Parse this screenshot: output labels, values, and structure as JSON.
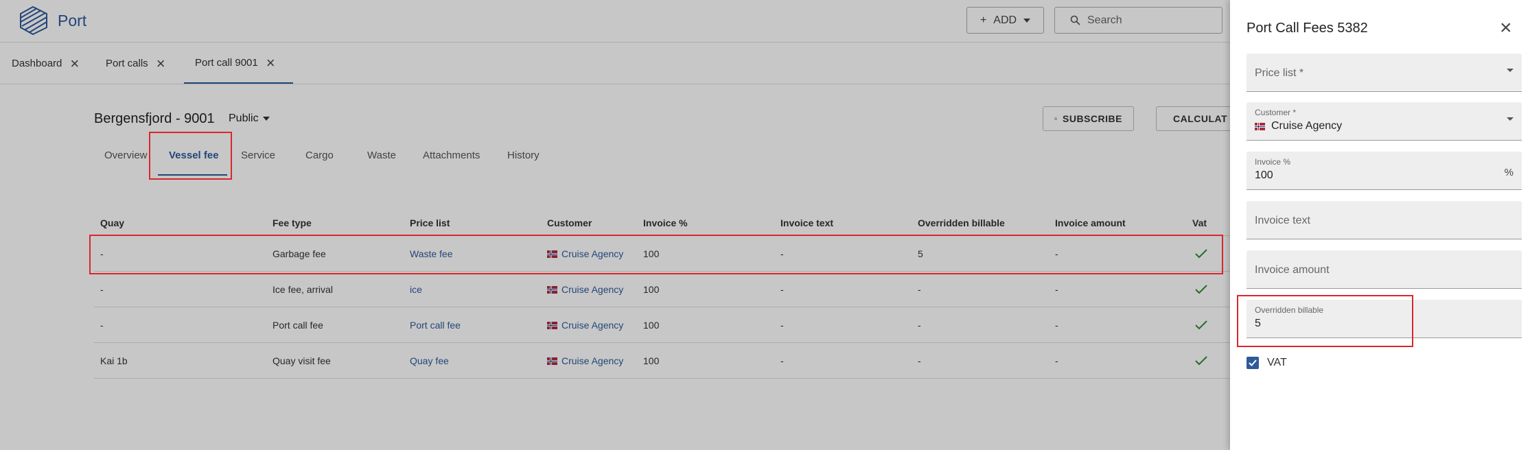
{
  "app": {
    "title": "Port"
  },
  "header": {
    "add_label": "ADD",
    "search_placeholder": "Search"
  },
  "page_tabs": [
    {
      "label": "Dashboard"
    },
    {
      "label": "Port calls"
    },
    {
      "label": "Port call 9001",
      "active": true
    }
  ],
  "vessel": {
    "title": "Bergensfjord - 9001",
    "visibility": "Public",
    "subscribe_label": "SUBSCRIBE",
    "calculate_label": "CALCULAT"
  },
  "sub_tabs": [
    {
      "label": "Overview"
    },
    {
      "label": "Vessel fee",
      "active": true
    },
    {
      "label": "Service"
    },
    {
      "label": "Cargo"
    },
    {
      "label": "Waste"
    },
    {
      "label": "Attachments"
    },
    {
      "label": "History"
    }
  ],
  "table": {
    "columns": [
      "Quay",
      "Fee type",
      "Price list",
      "Customer",
      "Invoice %",
      "Invoice text",
      "Overridden billable",
      "Invoice amount",
      "Vat"
    ],
    "rows": [
      {
        "quay": "-",
        "fee_type": "Garbage fee",
        "price_list": "Waste fee",
        "customer": "Cruise Agency",
        "invoice_pct": "100",
        "invoice_text": "-",
        "overridden": "5",
        "invoice_amount": "-",
        "vat": true
      },
      {
        "quay": "-",
        "fee_type": "Ice fee, arrival",
        "price_list": "ice",
        "customer": "Cruise Agency",
        "invoice_pct": "100",
        "invoice_text": "-",
        "overridden": "-",
        "invoice_amount": "-",
        "vat": true
      },
      {
        "quay": "-",
        "fee_type": "Port call fee",
        "price_list": "Port call fee",
        "customer": "Cruise Agency",
        "invoice_pct": "100",
        "invoice_text": "-",
        "overridden": "-",
        "invoice_amount": "-",
        "vat": true
      },
      {
        "quay": "Kai 1b",
        "fee_type": "Quay visit fee",
        "price_list": "Quay fee",
        "customer": "Cruise Agency",
        "invoice_pct": "100",
        "invoice_text": "-",
        "overridden": "-",
        "invoice_amount": "-",
        "vat": true
      }
    ]
  },
  "drawer": {
    "title": "Port Call Fees 5382",
    "price_list": {
      "placeholder": "Price list *"
    },
    "customer": {
      "label": "Customer *",
      "value": "Cruise Agency"
    },
    "invoice_pct": {
      "label": "Invoice %",
      "value": "100",
      "suffix": "%"
    },
    "invoice_text": {
      "placeholder": "Invoice text"
    },
    "invoice_amount": {
      "placeholder": "Invoice amount"
    },
    "overridden": {
      "label": "Overridden billable",
      "value": "5"
    },
    "vat": {
      "label": "VAT",
      "checked": true
    }
  },
  "colors": {
    "accent": "#2e5a9a",
    "highlight": "#d9262c",
    "check": "#2e8b2e"
  }
}
